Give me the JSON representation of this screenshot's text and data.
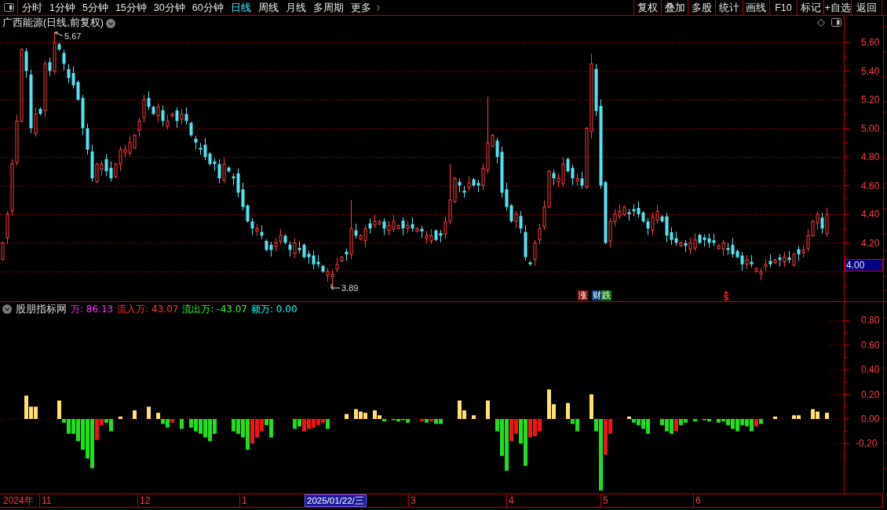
{
  "toolbar": {
    "periods": [
      {
        "label": "分时",
        "selected": false
      },
      {
        "label": "1分钟",
        "selected": false
      },
      {
        "label": "5分钟",
        "selected": false
      },
      {
        "label": "15分钟",
        "selected": false
      },
      {
        "label": "30分钟",
        "selected": false
      },
      {
        "label": "60分钟",
        "selected": false
      },
      {
        "label": "日线",
        "selected": true
      },
      {
        "label": "周线",
        "selected": false
      },
      {
        "label": "月线",
        "selected": false
      },
      {
        "label": "多周期",
        "selected": false
      },
      {
        "label": "更多",
        "selected": false
      }
    ],
    "buttons": [
      "复权",
      "叠加",
      "多股",
      "统计",
      "画线",
      "F10",
      "标记",
      "+自选",
      "返回"
    ]
  },
  "price_chart": {
    "title": "广西能源(日线,前复权)",
    "high_label": "5.67",
    "low_label": "3.89",
    "axis_labels": [
      "5.60",
      "5.40",
      "5.20",
      "5.00",
      "4.80",
      "4.60",
      "4.40",
      "4.20"
    ],
    "current_price": "4.00",
    "event_marks": [
      {
        "kind": "badge",
        "text": "涨",
        "color": "#8b1010"
      },
      {
        "kind": "badge",
        "text": "财",
        "color": "#0c3c78"
      },
      {
        "kind": "badge",
        "text": "跌",
        "color": "#137a13"
      },
      {
        "kind": "symbol",
        "text": "$",
        "color": "#ff2020"
      }
    ]
  },
  "indicator": {
    "name": "股朋指标网",
    "readings": [
      {
        "text": "万: 86.13",
        "color": "#ff33ff"
      },
      {
        "text": "流入万: 43.07",
        "color": "#ff3333"
      },
      {
        "text": "流出万: -43.07",
        "color": "#33ff33"
      },
      {
        "text": "额万: 0.00",
        "color": "#00ffff"
      }
    ],
    "axis_labels": [
      "0.80",
      "0.60",
      "0.40",
      "0.20",
      "0.00",
      "-0.20"
    ]
  },
  "date_axis": {
    "labels": [
      "2024年",
      "11",
      "12",
      "1",
      "3",
      "4",
      "5",
      "6"
    ],
    "cursor_date": "2025/01/22/三"
  }
}
